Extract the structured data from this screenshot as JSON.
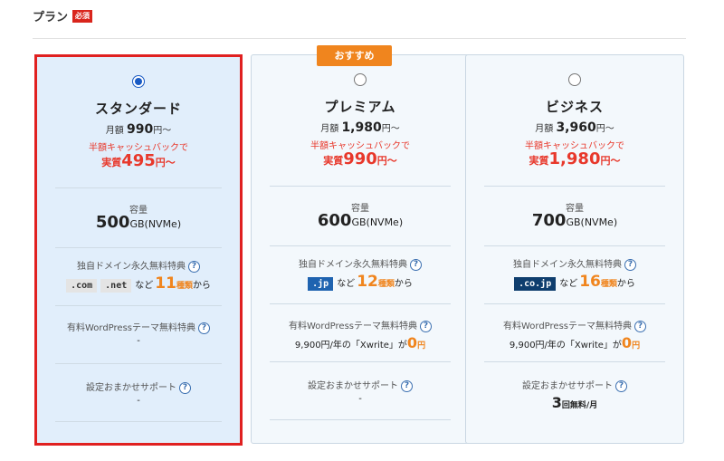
{
  "header": {
    "title": "プラン",
    "required_badge": "必須"
  },
  "recommend_badge": "おすすめ",
  "labels": {
    "capacity": "容量",
    "domain": "独自ドメイン永久無料特典",
    "wordpress": "有料WordPressテーマ無料特典",
    "support": "設定おまかせサポート",
    "help": "?",
    "monthly": "月額",
    "yen_tilde": "円～",
    "cashback": "半額キャッシュバックで",
    "effective": "実質",
    "storage_unit": "GB(NVMe)",
    "nado": "など",
    "shurui": "種類",
    "kara": "から",
    "yen": "円"
  },
  "plans": [
    {
      "name": "スタンダード",
      "selected": true,
      "price": "990",
      "effective_price": "495",
      "capacity": "500",
      "tlds": [
        ".com",
        ".net"
      ],
      "tld_count": "11",
      "wp_value": "-",
      "support_value": "-"
    },
    {
      "name": "プレミアム",
      "selected": false,
      "price": "1,980",
      "effective_price": "990",
      "capacity": "600",
      "tlds": [
        ".jp"
      ],
      "tld_count": "12",
      "wp_prefix": "9,900円/年の「Xwrite」が",
      "wp_zero": "0",
      "support_value": "-"
    },
    {
      "name": "ビジネス",
      "selected": false,
      "price": "3,960",
      "effective_price": "1,980",
      "capacity": "700",
      "tlds": [
        ".co.jp"
      ],
      "tld_count": "16",
      "wp_prefix": "9,900円/年の「Xwrite」が",
      "wp_zero": "0",
      "support_num": "3",
      "support_suffix": "回無料/月"
    }
  ],
  "colors": {
    "accent_red": "#e8382b",
    "accent_orange": "#f0851e",
    "selected_border": "#e02020",
    "radio_blue": "#1a5bc4"
  }
}
